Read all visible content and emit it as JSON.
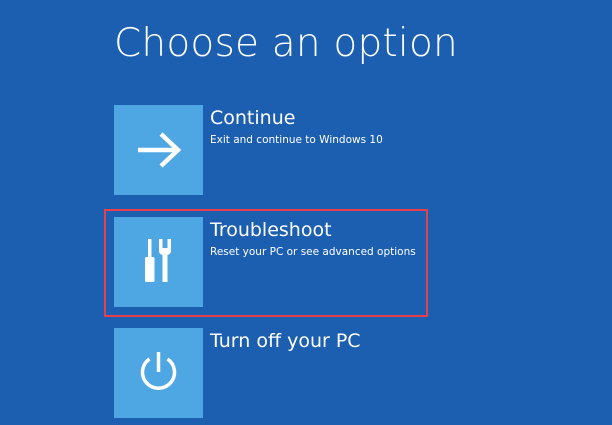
{
  "page": {
    "title": "Choose an option"
  },
  "options": [
    {
      "title": "Continue",
      "description": "Exit and continue to Windows 10",
      "icon": "arrow-right-icon"
    },
    {
      "title": "Troubleshoot",
      "description": "Reset your PC or see advanced options",
      "icon": "tools-icon",
      "highlighted": true
    },
    {
      "title": "Turn off your PC",
      "description": "",
      "icon": "power-icon"
    }
  ],
  "colors": {
    "background": "#1c5fb0",
    "tile": "#4ea6e2",
    "highlight_border": "#e8404b",
    "text": "#ffffff"
  }
}
